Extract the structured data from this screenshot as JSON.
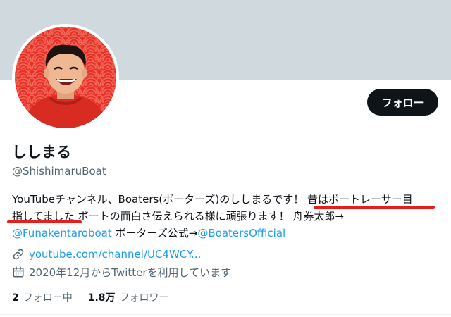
{
  "profile": {
    "display_name": "ししまる",
    "handle": "@ShishimaruBoat",
    "follow_label": "フォロー"
  },
  "bio": {
    "line1_a": "YouTubeチャンネル、Boaters(ボーターズ)のししまるです！",
    "line1_b": "昔はボートレーサー目",
    "line2_a": "指してました",
    "line2_b": "ボートの面白さ伝えられる様に頑張ります！ 舟券太郎→",
    "line3_link1": "@Funakentaroboat",
    "line3_text": " ボーターズ公式→",
    "line3_link2": "@BoatersOfficial"
  },
  "meta": {
    "website": "youtube.com/channel/UC4WCY...",
    "joined": "2020年12月からTwitterを利用しています"
  },
  "stats": {
    "following_count": "2",
    "following_label": "フォロー中",
    "followers_count": "1.8万",
    "followers_label": "フォロワー"
  },
  "icons": {
    "website": "link-icon",
    "joined": "calendar-icon"
  },
  "colors": {
    "banner": "#cfd9de",
    "avatar_bg": "#e8302a",
    "accent": "#1d9bf0",
    "highlight": "#e3201b",
    "button": "#0f1419"
  }
}
